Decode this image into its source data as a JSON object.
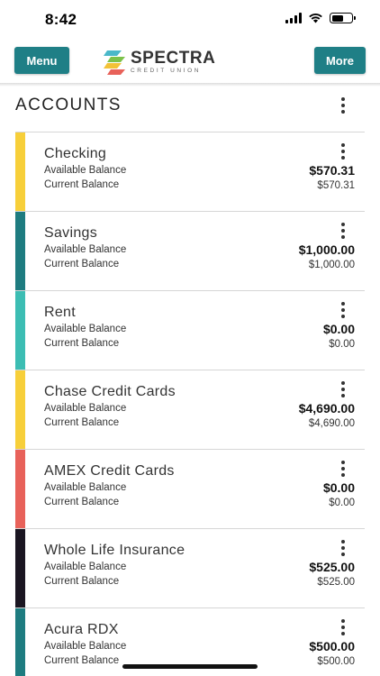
{
  "status": {
    "time": "8:42",
    "battery_level": 0.6
  },
  "header": {
    "menu_label": "Menu",
    "more_label": "More",
    "logo_name": "SPECTRA",
    "logo_sub": "CREDIT UNION"
  },
  "section": {
    "title": "ACCOUNTS"
  },
  "accounts": [
    {
      "name": "Checking",
      "color": "#f7cf3a",
      "available_label": "Available Balance",
      "available": "$570.31",
      "current_label": "Current Balance",
      "current": "$570.31"
    },
    {
      "name": "Savings",
      "color": "#1e7c80",
      "available_label": "Available Balance",
      "available": "$1,000.00",
      "current_label": "Current Balance",
      "current": "$1,000.00"
    },
    {
      "name": "Rent",
      "color": "#3cbdb3",
      "available_label": "Available Balance",
      "available": "$0.00",
      "current_label": "Current Balance",
      "current": "$0.00"
    },
    {
      "name": "Chase Credit Cards",
      "color": "#f7cf3a",
      "available_label": "Available Balance",
      "available": "$4,690.00",
      "current_label": "Current Balance",
      "current": "$4,690.00"
    },
    {
      "name": "AMEX Credit Cards",
      "color": "#e8625a",
      "available_label": "Available Balance",
      "available": "$0.00",
      "current_label": "Current Balance",
      "current": "$0.00"
    },
    {
      "name": "Whole Life Insurance",
      "color": "#1b1622",
      "available_label": "Available Balance",
      "available": "$525.00",
      "current_label": "Current Balance",
      "current": "$525.00"
    },
    {
      "name": "Acura RDX",
      "color": "#1e7c80",
      "available_label": "Available Balance",
      "available": "$500.00",
      "current_label": "Current Balance",
      "current": "$500.00"
    }
  ]
}
